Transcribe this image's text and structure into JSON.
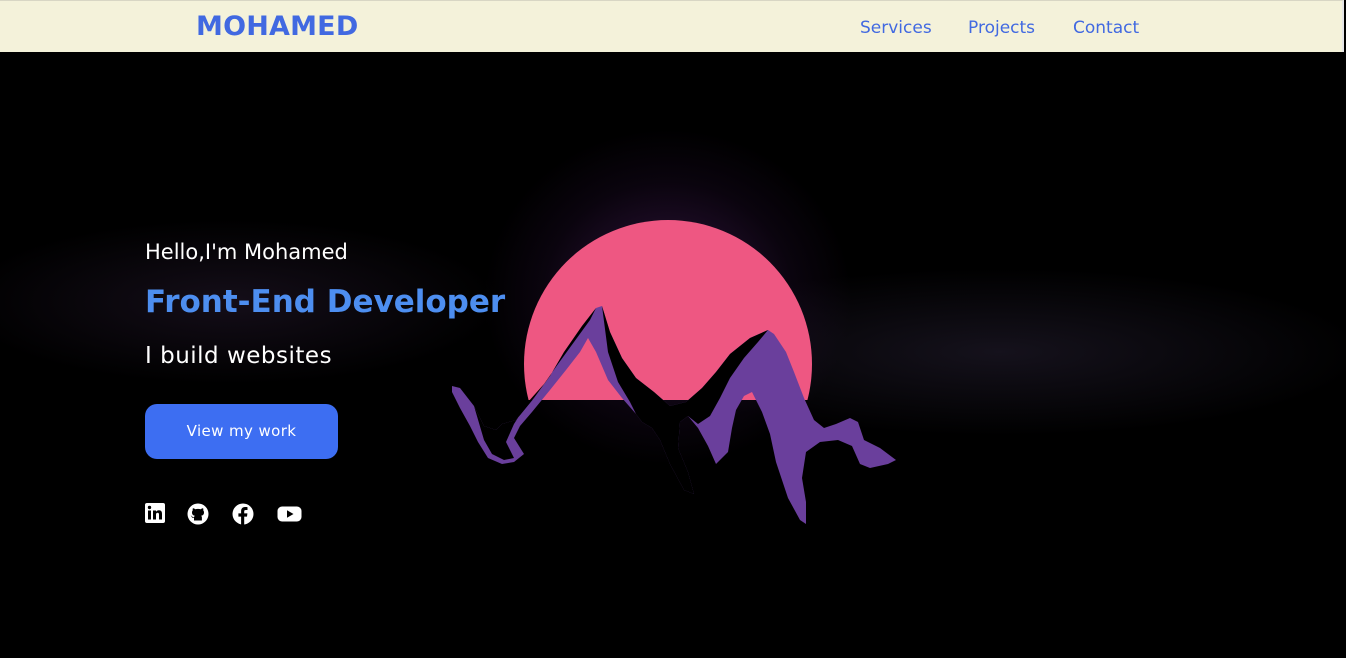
{
  "navbar": {
    "brand": "MOHAMED",
    "links": [
      {
        "label": "Services"
      },
      {
        "label": "Projects"
      },
      {
        "label": "Contact"
      }
    ]
  },
  "hero": {
    "greeting": "Hello,I'm Mohamed",
    "role": "Front-End Developer",
    "tagline": "I build websites",
    "cta_label": "View my work",
    "illustration": "mountain-sunset-illustration",
    "socials": [
      {
        "icon": "linkedin-icon"
      },
      {
        "icon": "github-icon"
      },
      {
        "icon": "facebook-icon"
      },
      {
        "icon": "youtube-icon"
      }
    ]
  },
  "colors": {
    "navbar_background": "#f4f2da",
    "brand_blue": "#4169e1",
    "role_blue": "#4d8ef0",
    "button_blue": "#3d6ef2",
    "hero_background": "#000000",
    "sun_pink": "#ee5782",
    "mountain_purple": "#6a3f9c"
  }
}
